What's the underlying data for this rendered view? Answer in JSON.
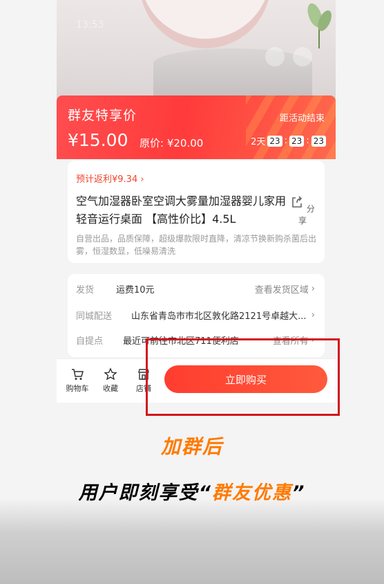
{
  "status": {
    "time": "13:53"
  },
  "promo": {
    "title": "群友特享价",
    "price": "¥15.00",
    "original_label": "原价:",
    "original_price": "¥20.00",
    "ends_label": "距活动结束",
    "countdown": {
      "days": "2天",
      "h": "23",
      "m": "23",
      "s": "23",
      "sep": ":"
    }
  },
  "product": {
    "rebate": "预计返利¥9.34",
    "name": "空气加湿器卧室空调大雾量加湿器婴儿家用轻音运行桌面 【高性价比】4.5L",
    "share_label": "分享",
    "desc": "自营出品，品质保障，超级爆款限时直降，清凉节换新购杀菌后出雾，恒湿数显，低噪易清洗"
  },
  "shipping": {
    "ship_label": "发货",
    "ship_value": "运费10元",
    "ship_link": "查看发货区域",
    "city_label": "同城配送",
    "city_value": "山东省青岛市市北区敦化路2121号卓越大...",
    "pickup_label": "自提点",
    "pickup_value": "最近可前往市北区711便利店",
    "pickup_link": "查看所有"
  },
  "bottom_bar": {
    "cart_label": "购物车",
    "fav_label": "收藏",
    "shop_label": "店铺",
    "buy_label": "立即购买"
  },
  "caption": {
    "line1": "加群后",
    "line2_prefix": "用户即刻享受“",
    "line2_highlight": "群友优惠",
    "line2_suffix": "”"
  },
  "colors": {
    "accent": "#ff3d2f",
    "caption_orange": "#ff7a00",
    "frame_red": "#d3141c"
  }
}
